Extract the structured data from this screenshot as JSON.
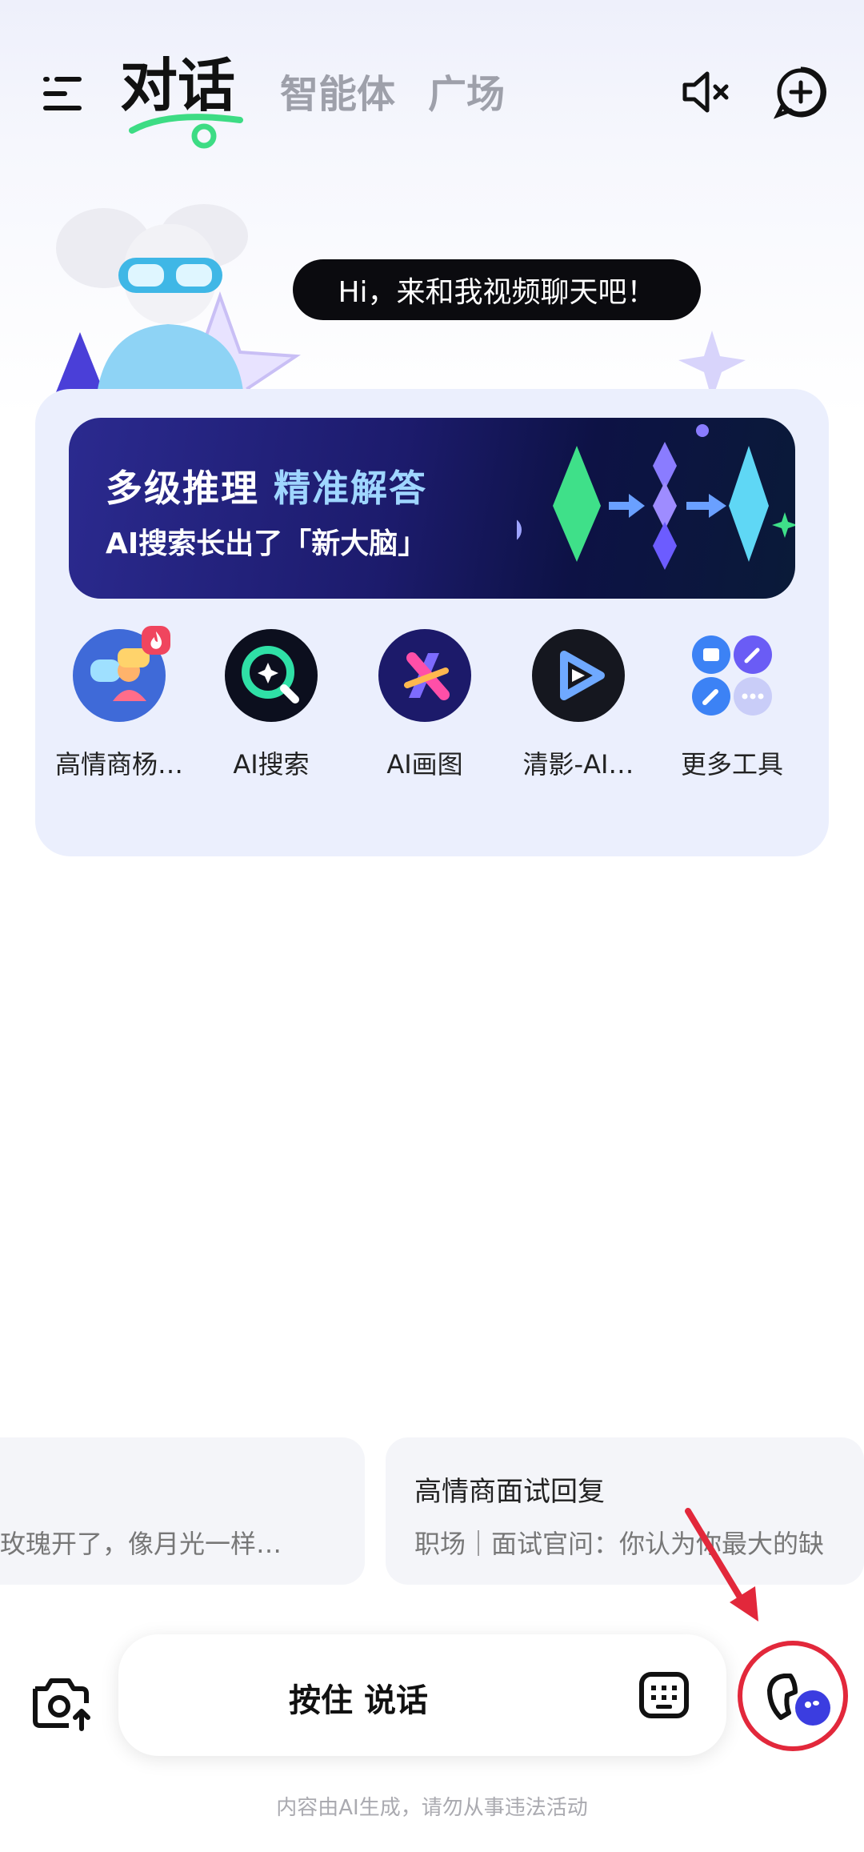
{
  "header": {
    "tabs": [
      {
        "label": "对话",
        "active": true
      },
      {
        "label": "智能体",
        "active": false
      },
      {
        "label": "广场",
        "active": false
      }
    ],
    "icons": [
      "menu-icon",
      "mute-icon",
      "new-chat-icon"
    ]
  },
  "greeting": {
    "bubble_text": "Hi，来和我视频聊天吧！"
  },
  "banner": {
    "title_part1": "多级推理",
    "title_part2": "精准解答",
    "subtitle": "AI搜索长出了「新大脑」"
  },
  "tools": [
    {
      "label": "高情商杨…",
      "icon": "chat-people-icon",
      "badge": "fire-badge"
    },
    {
      "label": "AI搜索",
      "icon": "ai-search-icon"
    },
    {
      "label": "AI画图",
      "icon": "ai-draw-icon"
    },
    {
      "label": "清影-AI…",
      "icon": "video-play-icon"
    },
    {
      "label": "更多工具",
      "icon": "more-tools-icon"
    }
  ],
  "suggestions": [
    {
      "title": "",
      "desc": "玫瑰开了，像月光一样…"
    },
    {
      "title": "高情商面试回复",
      "desc": "职场｜面试官问：你认为你最大的缺"
    }
  ],
  "input": {
    "talk_label": "按住 说话",
    "icons": [
      "camera-upload-icon",
      "keyboard-icon",
      "voice-call-icon"
    ]
  },
  "disclaimer": "内容由AI生成，请勿从事违法活动",
  "colors": {
    "accent_green": "#3ddc84",
    "banner_bg": "#1c1b6c",
    "card_bg": "#ebeffd",
    "annotation_red": "#e2283b"
  }
}
